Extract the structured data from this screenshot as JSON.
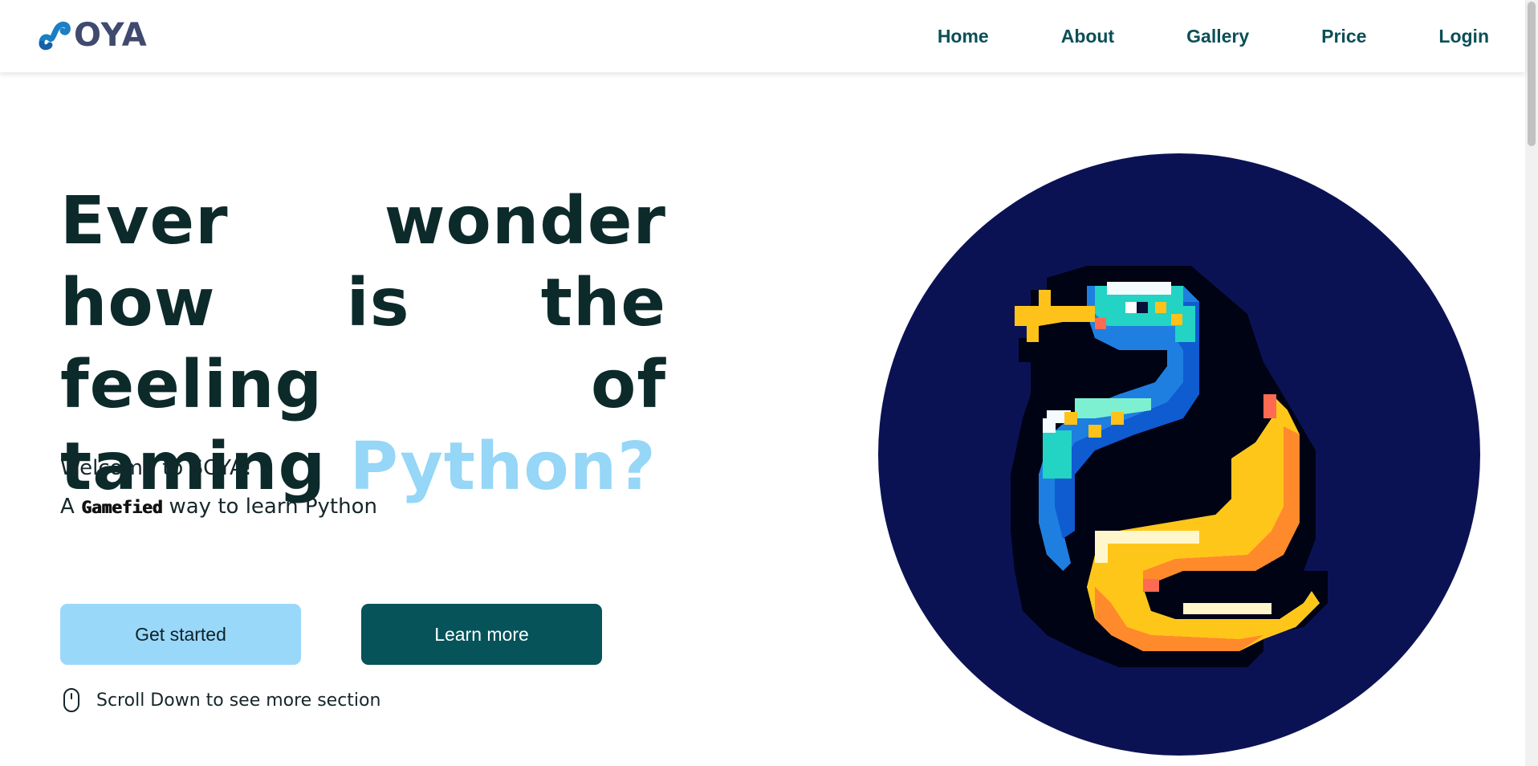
{
  "brand": {
    "logo_text": "OYA",
    "logo_colors": {
      "mark": "#1a7fc4",
      "text": "#3f4a6e"
    }
  },
  "nav": {
    "items": [
      "Home",
      "About",
      "Gallery",
      "Price",
      "Login"
    ]
  },
  "hero": {
    "headline_part1": "Ever wonder how is the feeling of taming",
    "headline_accent": "Python?",
    "welcome": "Welcome to SOYA!",
    "tagline_prefix": "A",
    "tagline_pixel_word": "Gamefied",
    "tagline_suffix": "way to learn Python",
    "primary_button": "Get started",
    "secondary_button": "Learn more",
    "scroll_hint": "Scroll Down to see more section",
    "scroll_icon": "mouse-icon"
  },
  "illustration": {
    "name": "pixel-python-snake",
    "background_color": "#0b1254"
  },
  "colors": {
    "accent": "#96d6f7",
    "primary_button": "#9ad8fa",
    "secondary_button": "#06535a",
    "nav_text": "#0a4f57",
    "headline_text": "#0d2a2b"
  }
}
